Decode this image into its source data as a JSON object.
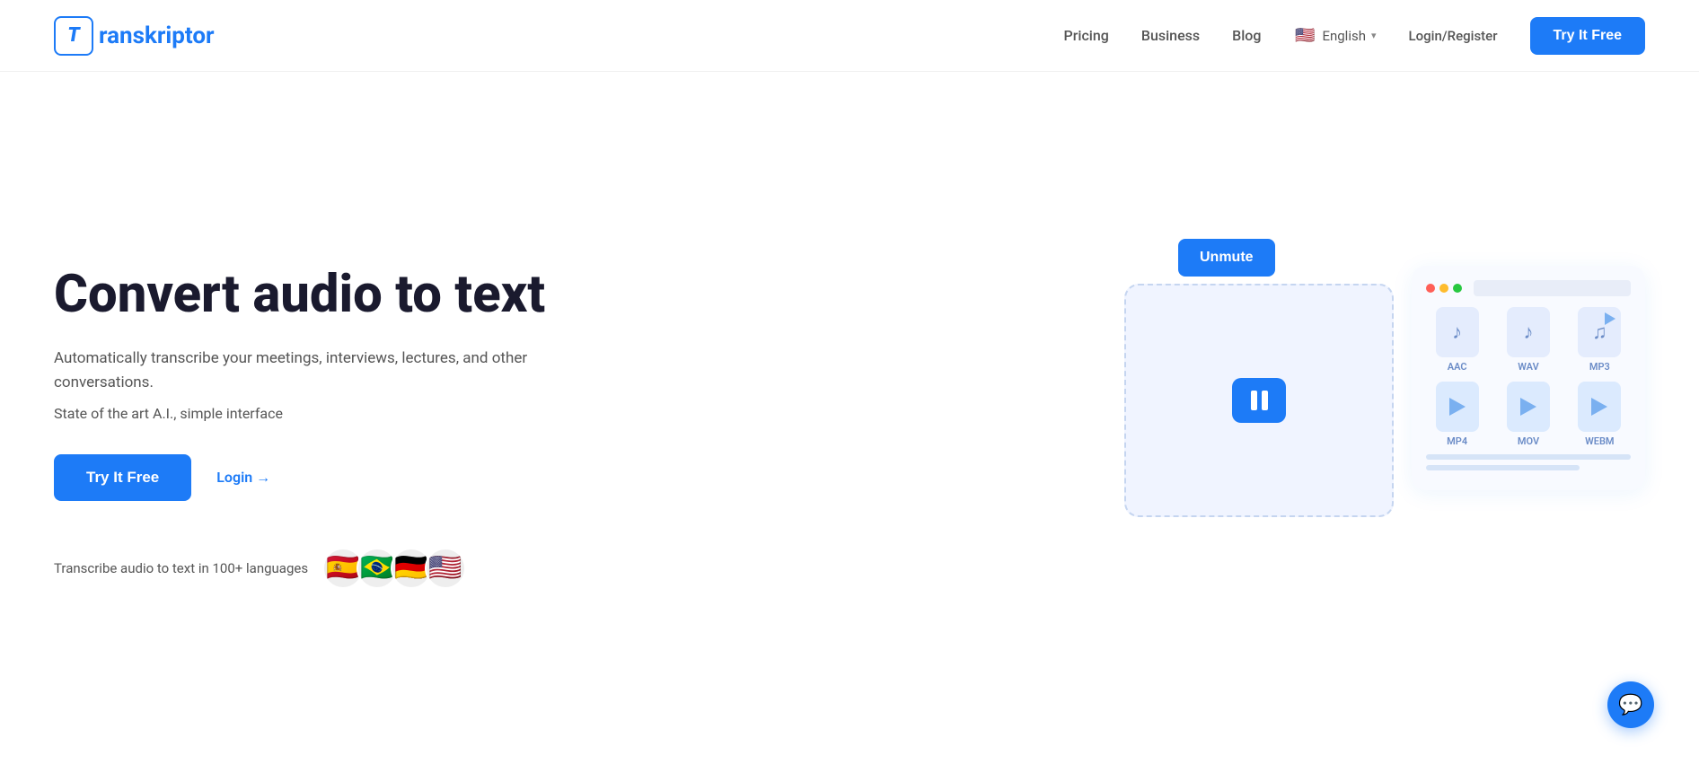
{
  "navbar": {
    "logo_letter": "T",
    "logo_name": "ranskriptor",
    "links": [
      {
        "id": "pricing",
        "label": "Pricing"
      },
      {
        "id": "business",
        "label": "Business"
      },
      {
        "id": "blog",
        "label": "Blog"
      }
    ],
    "language": "English",
    "login_register": "Login/Register",
    "try_btn": "Try It Free"
  },
  "hero": {
    "title": "Convert audio to text",
    "subtitle1": "Automatically transcribe your meetings, interviews, lectures, and other conversations.",
    "subtitle2": "State of the art A.I., simple interface",
    "try_btn": "Try It Free",
    "login_link": "Login →",
    "langs_text": "Transcribe audio to text in 100+ languages",
    "flags": [
      "🇪🇸",
      "🇧🇷",
      "🇩🇪",
      "🇺🇸"
    ],
    "unmute_btn": "Unmute",
    "file_labels": [
      "AAC",
      "WAV",
      "MP3",
      "MP4",
      "MOV",
      "WEBM"
    ]
  },
  "chat": {
    "icon": "💬"
  }
}
